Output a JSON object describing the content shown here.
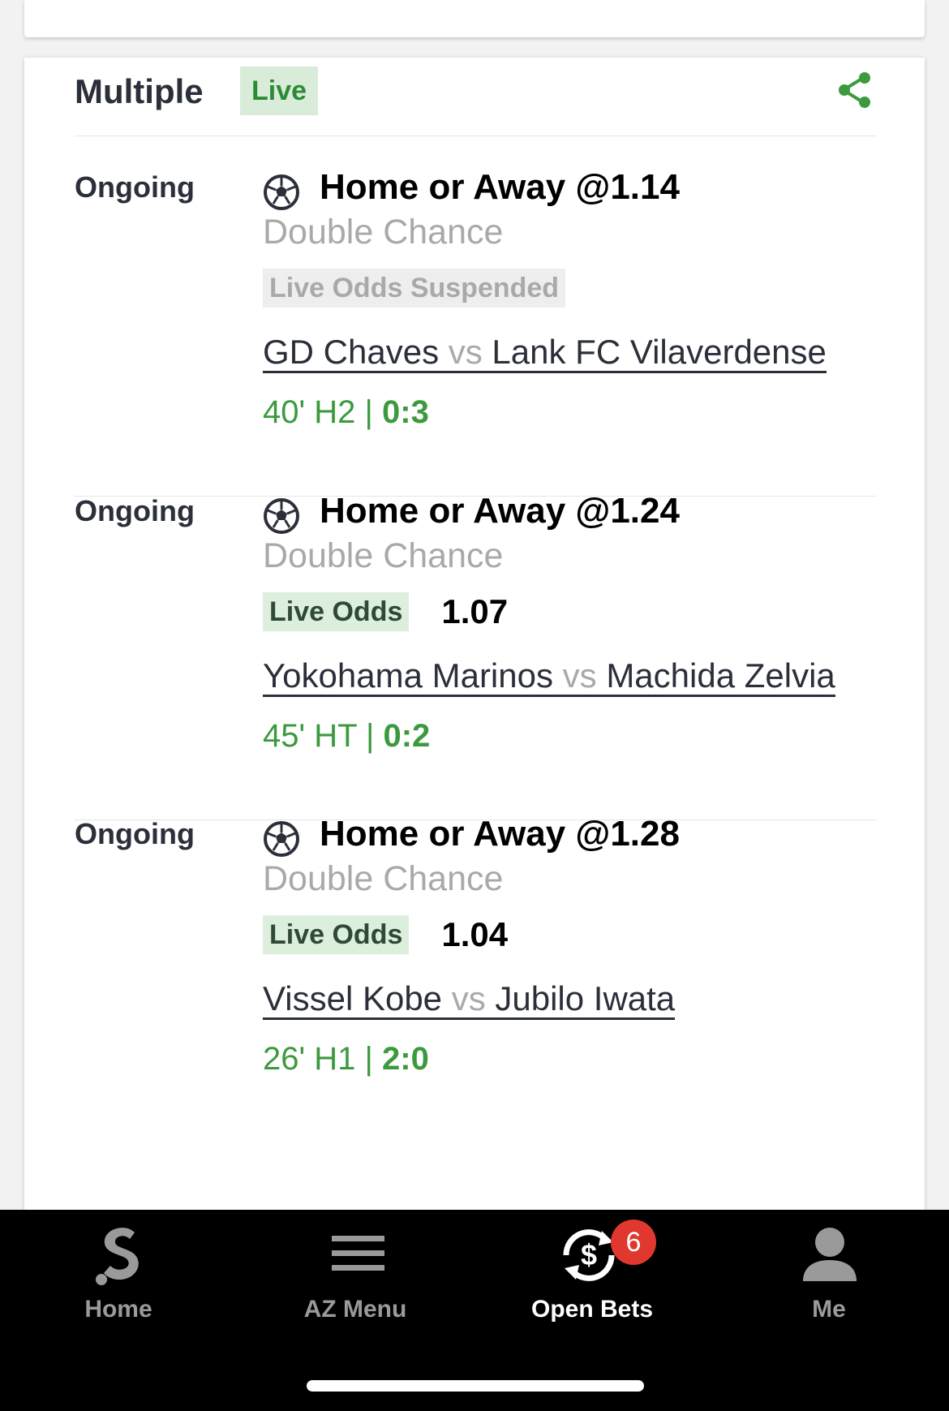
{
  "bet": {
    "type_label": "Multiple",
    "live_badge": "Live",
    "legs": [
      {
        "status": "Ongoing",
        "selection": "Home or Away @1.14",
        "market": "Double Chance",
        "odds_tag": "Live Odds Suspended",
        "odds_value": "",
        "home_team": "GD Chaves ",
        "vs": "vs",
        "away_team": " Lank FC Vilaverdense",
        "time": "40' H2 | ",
        "score": "0:3"
      },
      {
        "status": "Ongoing",
        "selection": "Home or Away @1.24",
        "market": "Double Chance",
        "odds_tag": "Live Odds",
        "odds_value": "1.07",
        "home_team": "Yokohama Marinos ",
        "vs": "vs",
        "away_team": " Machida Zelvia",
        "time": "45' HT | ",
        "score": "0:2"
      },
      {
        "status": "Ongoing",
        "selection": "Home or Away @1.28",
        "market": "Double Chance",
        "odds_tag": "Live Odds",
        "odds_value": "1.04",
        "home_team": "Vissel Kobe ",
        "vs": "vs",
        "away_team": " Jubilo Iwata",
        "time": "26' H1 | ",
        "score": "2:0"
      }
    ]
  },
  "tabbar": {
    "items": [
      {
        "label": "Home",
        "icon": "home-s-logo-icon"
      },
      {
        "label": "AZ Menu",
        "icon": "hamburger-menu-icon"
      },
      {
        "label": "Open Bets",
        "icon": "open-bets-dollar-icon",
        "badge": "6",
        "active": true
      },
      {
        "label": "Me",
        "icon": "user-icon"
      }
    ]
  },
  "colors": {
    "accent_green": "#3c9a3e",
    "live_badge_bg": "#d8ecd9",
    "badge_red": "#e0382e"
  }
}
